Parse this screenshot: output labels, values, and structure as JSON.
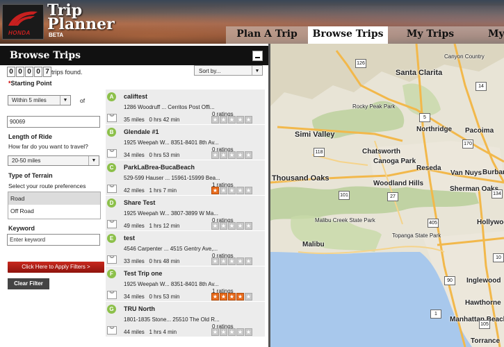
{
  "header": {
    "brand": "HONDA",
    "title_line1": "Trip",
    "title_line2": "Planner",
    "beta": "BETA",
    "tabs": [
      {
        "label": "Plan A Trip"
      },
      {
        "label": "Browse Trips",
        "active": true
      },
      {
        "label": "My Trips"
      },
      {
        "label": "My"
      }
    ]
  },
  "panel": {
    "title": "Browse Trips",
    "count_digits": [
      "0",
      "0",
      "0",
      "0",
      "7"
    ],
    "count_label": "trips found.",
    "sort_placeholder": "Sort by..."
  },
  "form": {
    "starting_point_label": "Starting Point",
    "within_value": "Within 5 miles",
    "of_label": "of",
    "zip_value": "90069",
    "length_label": "Length of Ride",
    "length_sub": "How far do you want to travel?",
    "length_value": "20-50 miles",
    "terrain_label": "Type of Terrain",
    "terrain_sub": "Select your route preferences",
    "terrain_options": [
      "Road",
      "Off Road"
    ],
    "terrain_selected": "Road",
    "keyword_label": "Keyword",
    "keyword_placeholder": "Enter keyword",
    "apply_label": "Click Here to Apply Filters  >",
    "clear_label": "Clear Filter"
  },
  "trips": [
    {
      "letter": "A",
      "name": "califtest",
      "addr": "1286 Woodruff ...   Cerritos Post Offi...",
      "ratings": "0 ratings",
      "miles": "35 miles",
      "time": "0 hrs 42 min",
      "stars": 0
    },
    {
      "letter": "B",
      "name": "Glendale #1",
      "addr": "1925 Weepah W...  8351-8401 8th Av...",
      "ratings": "0 ratings",
      "miles": "34 miles",
      "time": "0 hrs 53 min",
      "stars": 0
    },
    {
      "letter": "C",
      "name": "ParkLaBrea-BucaBeach",
      "addr": "529-599 Hauser ...  15961-15999 Bea...",
      "ratings": "1 ratings",
      "miles": "42 miles",
      "time": "1 hrs 7 min",
      "stars": 1
    },
    {
      "letter": "D",
      "name": "Share Test",
      "addr": "1925 Weepah W...  3807-3899 W Ma...",
      "ratings": "0 ratings",
      "miles": "49 miles",
      "time": "1 hrs 12 min",
      "stars": 0
    },
    {
      "letter": "E",
      "name": "test",
      "addr": "4546 Carpenter ...  4515 Gentry Ave,...",
      "ratings": "0 ratings",
      "miles": "33 miles",
      "time": "0 hrs 48 min",
      "stars": 0
    },
    {
      "letter": "F",
      "name": "Test Trip one",
      "addr": "1925 Weepah W...  8351-8401 8th Av...",
      "ratings": "1 ratings",
      "miles": "34 miles",
      "time": "0 hrs 53 min",
      "stars": 4
    },
    {
      "letter": "G",
      "name": "TRU North",
      "addr": "1801-1835 Stone...  25510 The Old R...",
      "ratings": "0 ratings",
      "miles": "44 miles",
      "time": "1 hrs 4 min",
      "stars": 0
    }
  ],
  "map": {
    "labels": [
      "Canyon Country",
      "Santa Clarita",
      "Rocky Peak Park",
      "Simi Valley",
      "Northridge",
      "Pacoima",
      "Chatsworth",
      "Canoga Park",
      "Reseda",
      "Van Nuys",
      "Burbank",
      "Thousand Oaks",
      "Woodland Hills",
      "Sherman Oaks",
      "Malibu Creek State Park",
      "Topanga State Park",
      "Hollywood",
      "Malibu",
      "Inglewood",
      "Hawthorne",
      "Manhattan Beach",
      "Torrance"
    ],
    "shields": [
      "126",
      "14",
      "5",
      "118",
      "101",
      "405",
      "10",
      "105",
      "1",
      "170",
      "134",
      "27",
      "90"
    ]
  }
}
